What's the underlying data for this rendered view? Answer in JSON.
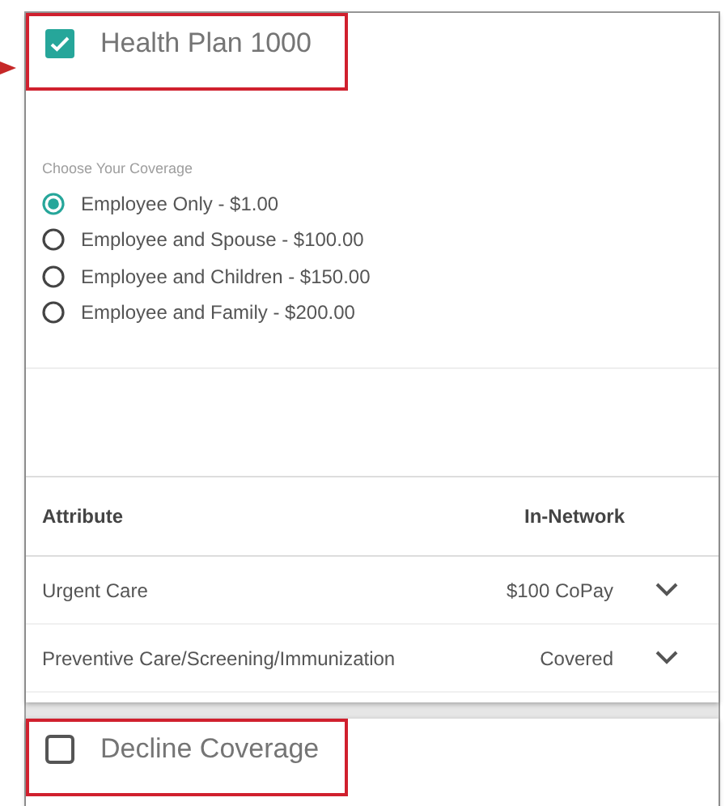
{
  "plans": [
    {
      "title": "Health Plan 1000",
      "checked": true,
      "highlighted": true,
      "coverage": {
        "label": "Choose Your Coverage",
        "options": [
          {
            "label": "Employee Only - $1.00",
            "selected": true
          },
          {
            "label": "Employee and Spouse - $100.00",
            "selected": false
          },
          {
            "label": "Employee and Children - $150.00",
            "selected": false
          },
          {
            "label": "Employee and Family - $200.00",
            "selected": false
          }
        ]
      },
      "table": {
        "columns": [
          "Attribute",
          "In-Network"
        ],
        "rows": [
          {
            "attribute": "Urgent Care",
            "value": "$100 CoPay",
            "expanded": false
          },
          {
            "attribute": "Preventive Care/Screening/Immunization",
            "value": "Covered",
            "expanded": false
          }
        ]
      }
    },
    {
      "title": "Decline Coverage",
      "checked": false,
      "highlighted": true
    }
  ]
}
